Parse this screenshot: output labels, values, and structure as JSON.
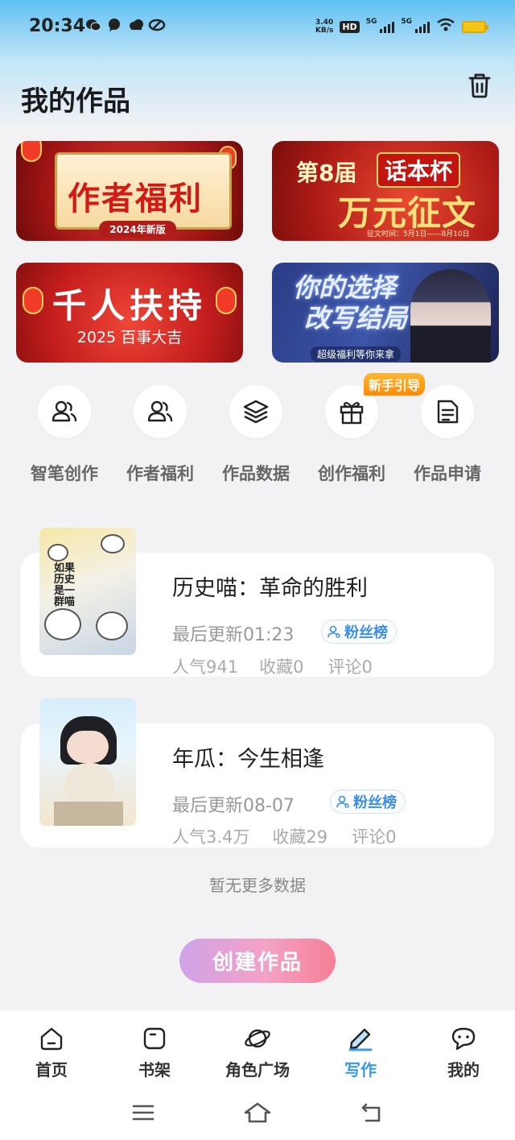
{
  "status_bar": {
    "time": "20:34",
    "net_speed_value": "3.40",
    "net_speed_unit": "KB/s",
    "hd_label": "HD",
    "sim1_label": "5G",
    "sim2_label": "5G"
  },
  "header": {
    "title": "我的作品"
  },
  "banners": [
    {
      "title": "作者福利",
      "tag": "2024年新版"
    },
    {
      "prefix": "第8届",
      "badge": "话本杯",
      "title": "万元征文",
      "date": "征文时间：5月1日——8月10日"
    },
    {
      "title": "千人扶持",
      "subtitle": "2025 百事大吉"
    },
    {
      "title_line1": "你的选择",
      "title_line2": "改写结局",
      "subtitle": "超级福利等你来拿"
    }
  ],
  "quick_actions": [
    {
      "label": "智笔创作",
      "icon": "users-icon"
    },
    {
      "label": "作者福利",
      "icon": "users-icon"
    },
    {
      "label": "作品数据",
      "icon": "layers-icon"
    },
    {
      "label": "创作福利",
      "icon": "gift-icon"
    },
    {
      "label": "作品申请",
      "icon": "document-icon"
    }
  ],
  "new_badge": "新手引导",
  "works": [
    {
      "title": "历史喵：革命的胜利",
      "updated": "最后更新01:23",
      "fans_label": "粉丝榜",
      "popularity": "人气941",
      "favorites": "收藏0",
      "comments": "评论0",
      "cover_text": "如果历史是一群喵"
    },
    {
      "title": "年瓜：今生相逢",
      "updated": "最后更新08-07",
      "fans_label": "粉丝榜",
      "popularity": "人气3.4万",
      "favorites": "收藏29",
      "comments": "评论0"
    }
  ],
  "footer_text": "暂无更多数据",
  "create_button": "创建作品",
  "nav": [
    {
      "label": "首页",
      "icon": "home-icon",
      "active": false
    },
    {
      "label": "书架",
      "icon": "bookshelf-icon",
      "active": false
    },
    {
      "label": "角色广场",
      "icon": "planet-icon",
      "active": false
    },
    {
      "label": "写作",
      "icon": "pen-icon",
      "active": true
    },
    {
      "label": "我的",
      "icon": "chat-icon",
      "active": false
    }
  ],
  "colors": {
    "accent": "#3b9ae8",
    "create_start": "#cfa3e8",
    "create_end": "#f57f96",
    "badge": "#ff9a10"
  }
}
